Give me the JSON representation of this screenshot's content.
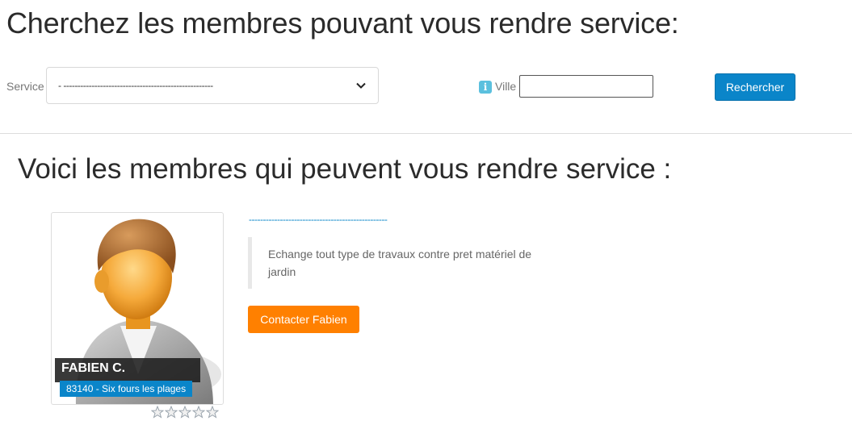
{
  "search": {
    "title": "Cherchez les membres pouvant vous rendre service:",
    "service_label": "Service",
    "service_selected": "- -----------------------------------------------------",
    "ville_label": "Ville",
    "ville_value": "",
    "search_button": "Rechercher"
  },
  "results": {
    "title": "Voici les membres qui peuvent vous rendre service :",
    "members": [
      {
        "name": "FABIEN C.",
        "location": "83140 - Six fours les plages",
        "link_text": "-------------------------------------------------",
        "description": "Echange tout type de travaux contre pret matériel de jardin",
        "contact_button": "Contacter Fabien",
        "rating": 0
      }
    ]
  },
  "colors": {
    "primary": "#0a85c9",
    "accent": "#ff8000",
    "info": "#5bc0de"
  }
}
